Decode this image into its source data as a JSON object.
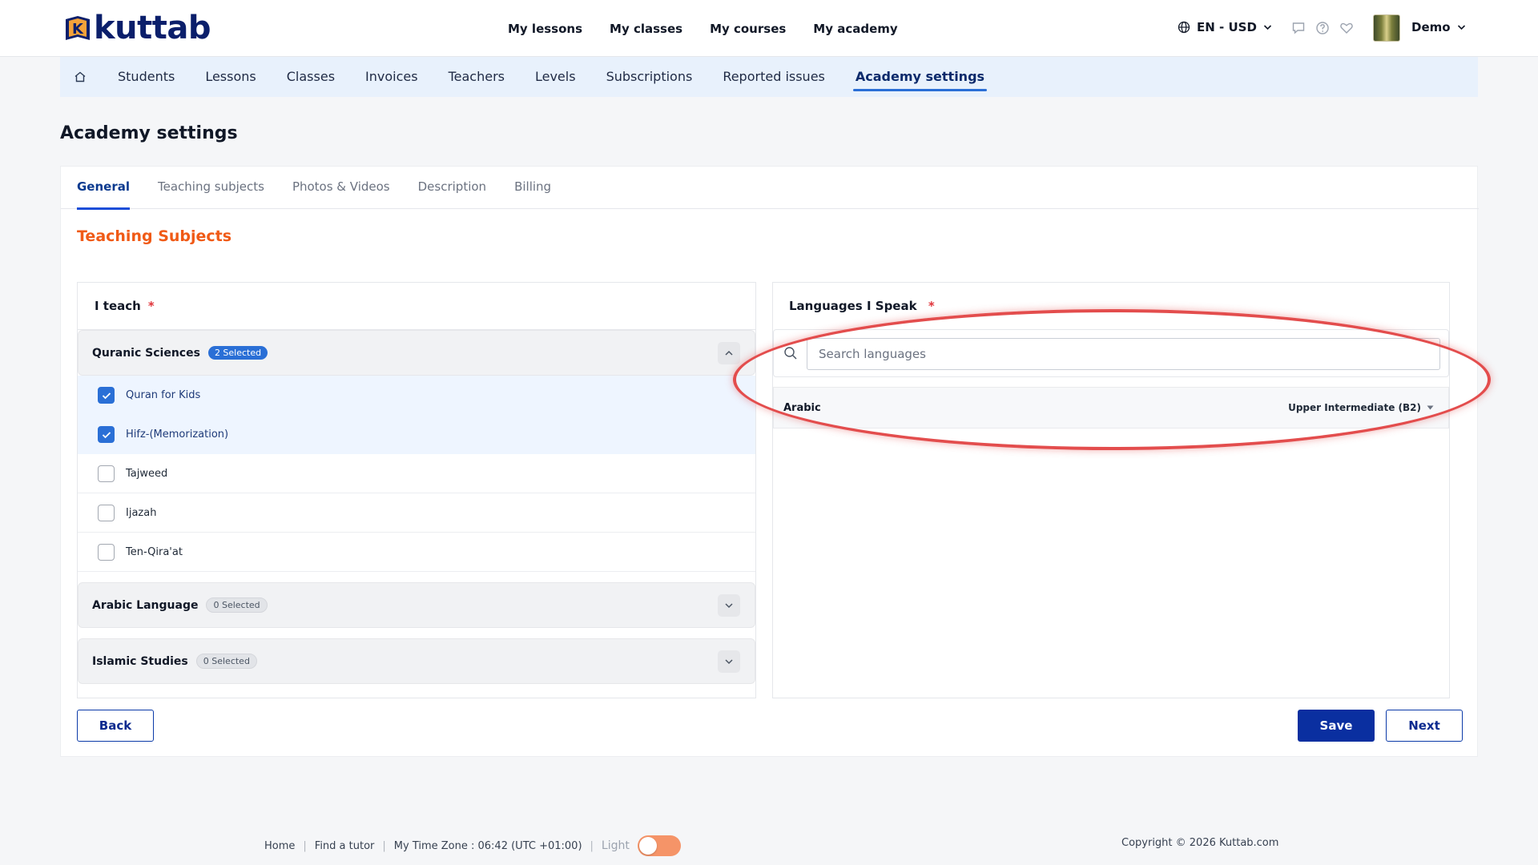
{
  "header": {
    "brand": "kuttab",
    "nav": [
      "My lessons",
      "My classes",
      "My courses",
      "My academy"
    ],
    "locale": "EN - USD",
    "user_name": "Demo"
  },
  "subnav": {
    "items": [
      "Students",
      "Lessons",
      "Classes",
      "Invoices",
      "Teachers",
      "Levels",
      "Subscriptions",
      "Reported issues",
      "Academy settings"
    ],
    "active": "Academy settings"
  },
  "page": {
    "title": "Academy settings"
  },
  "tabs": {
    "items": [
      "General",
      "Teaching subjects",
      "Photos & Videos",
      "Description",
      "Billing"
    ],
    "active": "General"
  },
  "section": {
    "title": "Teaching Subjects"
  },
  "teach": {
    "label": "I teach",
    "required": "*",
    "groups": [
      {
        "name": "Quranic Sciences",
        "badge": "2 Selected",
        "expanded": true,
        "options": [
          {
            "label": "Quran for Kids",
            "checked": true
          },
          {
            "label": "Hifz-(Memorization)",
            "checked": true
          },
          {
            "label": "Tajweed",
            "checked": false
          },
          {
            "label": "Ijazah",
            "checked": false
          },
          {
            "label": "Ten-Qira'at",
            "checked": false
          }
        ]
      },
      {
        "name": "Arabic Language",
        "badge": "0 Selected",
        "expanded": false
      },
      {
        "name": "Islamic Studies",
        "badge": "0 Selected",
        "expanded": false
      }
    ]
  },
  "languages": {
    "label": "Languages I Speak",
    "required": "*",
    "search_placeholder": "Search languages",
    "items": [
      {
        "name": "Arabic",
        "level": "Upper Intermediate (B2)"
      }
    ]
  },
  "actions": {
    "back": "Back",
    "save": "Save",
    "next": "Next"
  },
  "footer": {
    "links": [
      "Home",
      "Find a tutor",
      "My Time Zone : 06:42 (UTC +01:00)"
    ],
    "theme_label": "Light",
    "copyright": "Copyright © 2026 Kuttab.com"
  },
  "colors": {
    "brand_navy": "#0b1f6b",
    "primary": "#0a2fa0",
    "accent_orange": "#f05a16",
    "selected_blue": "#2a6fd6",
    "highlight_red": "#e34d4d"
  },
  "icons": [
    "home-icon",
    "globe-icon",
    "chevron-down-icon",
    "chat-icon",
    "help-icon",
    "heart-icon",
    "search-icon",
    "check-icon",
    "chevron-up-icon",
    "caret-down-icon"
  ]
}
